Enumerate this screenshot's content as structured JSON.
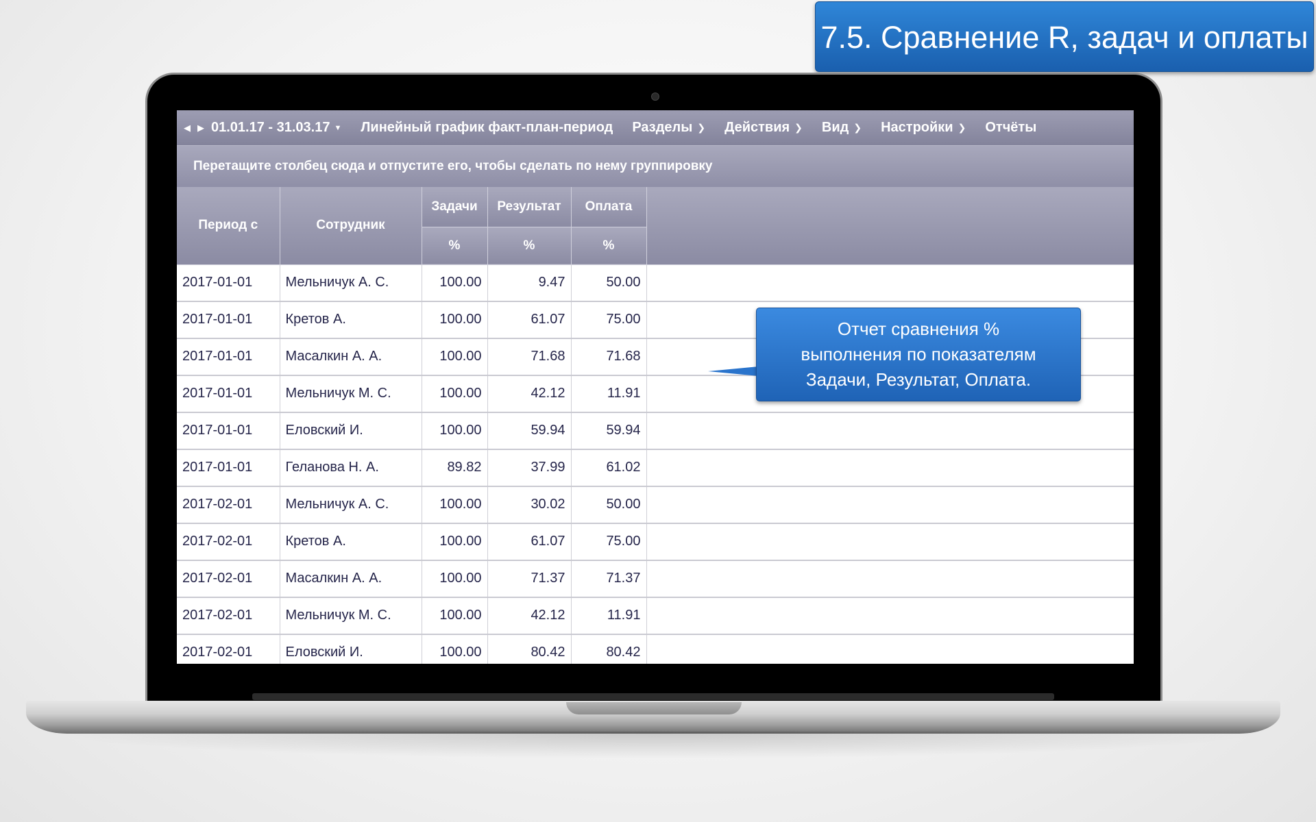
{
  "slide_title": "7.5. Сравнение R, задач и оплаты",
  "toolbar": {
    "prev_icon": "triangle-left-icon",
    "next_icon": "triangle-right-icon",
    "date_range": "01.01.17 - 31.03.17",
    "report_name": "Линейный график факт-план-период",
    "menu_sections": "Разделы",
    "menu_actions": "Действия",
    "menu_view": "Вид",
    "menu_settings": "Настройки",
    "menu_reports": "Отчёты"
  },
  "group_hint": "Перетащите столбец сюда и отпустите его, чтобы сделать по нему группировку",
  "table": {
    "headers": {
      "period": "Период с",
      "employee": "Сотрудник",
      "tasks": "Задачи",
      "result": "Результат",
      "payment": "Оплата",
      "unit": "%"
    },
    "rows": [
      {
        "period": "2017-01-01",
        "employee": "Мельничук А. С.",
        "tasks": "100.00",
        "result": "9.47",
        "payment": "50.00"
      },
      {
        "period": "2017-01-01",
        "employee": "Кретов А.",
        "tasks": "100.00",
        "result": "61.07",
        "payment": "75.00"
      },
      {
        "period": "2017-01-01",
        "employee": "Масалкин А. А.",
        "tasks": "100.00",
        "result": "71.68",
        "payment": "71.68"
      },
      {
        "period": "2017-01-01",
        "employee": "Мельничук М. С.",
        "tasks": "100.00",
        "result": "42.12",
        "payment": "11.91"
      },
      {
        "period": "2017-01-01",
        "employee": "Еловский И.",
        "tasks": "100.00",
        "result": "59.94",
        "payment": "59.94"
      },
      {
        "period": "2017-01-01",
        "employee": "Геланова Н. А.",
        "tasks": "89.82",
        "result": "37.99",
        "payment": "61.02"
      },
      {
        "period": "2017-02-01",
        "employee": "Мельничук А. С.",
        "tasks": "100.00",
        "result": "30.02",
        "payment": "50.00"
      },
      {
        "period": "2017-02-01",
        "employee": "Кретов А.",
        "tasks": "100.00",
        "result": "61.07",
        "payment": "75.00"
      },
      {
        "period": "2017-02-01",
        "employee": "Масалкин А. А.",
        "tasks": "100.00",
        "result": "71.37",
        "payment": "71.37"
      },
      {
        "period": "2017-02-01",
        "employee": "Мельничук М. С.",
        "tasks": "100.00",
        "result": "42.12",
        "payment": "11.91"
      },
      {
        "period": "2017-02-01",
        "employee": "Еловский И.",
        "tasks": "100.00",
        "result": "80.42",
        "payment": "80.42"
      }
    ]
  },
  "callout": {
    "line1": "Отчет сравнения %",
    "line2": "выполнения по показателям",
    "line3": "Задачи, Результат, Оплата."
  },
  "colors": {
    "banner": "#1f6bbf",
    "toolbar": "#8f8fa7",
    "cell_text": "#25254a",
    "callout": "#2a74cc"
  }
}
